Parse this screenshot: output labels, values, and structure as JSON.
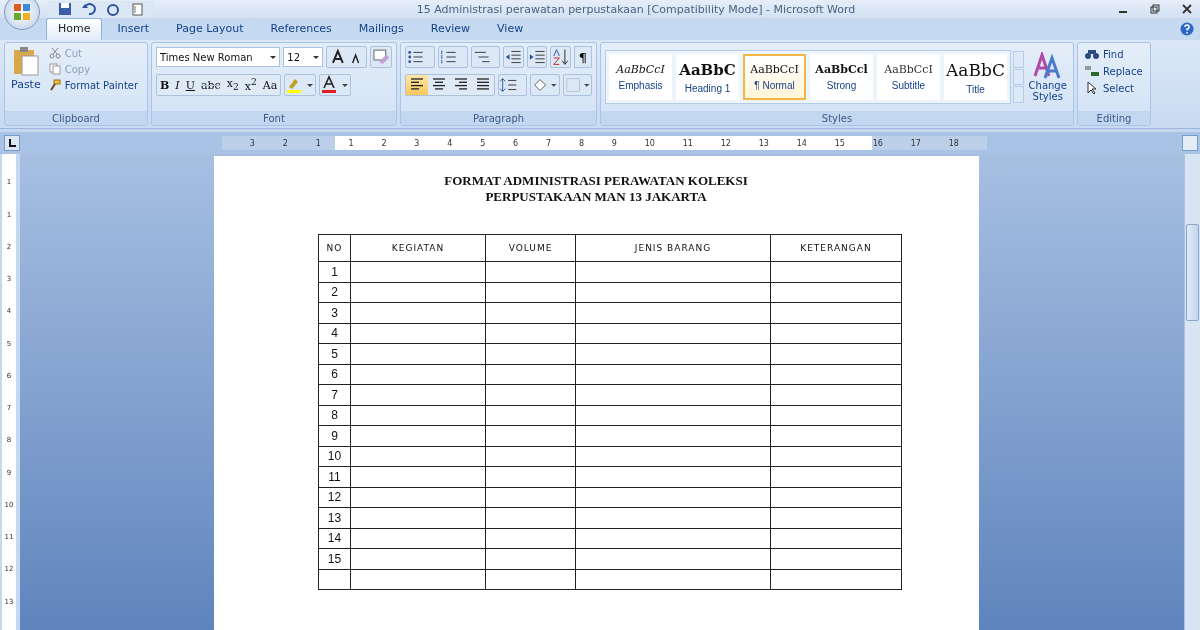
{
  "window": {
    "title": "15 Administrasi perawatan perpustakaan [Compatibility Mode] - Microsoft Word"
  },
  "tabs": [
    {
      "label": "Home",
      "selected": true
    },
    {
      "label": "Insert",
      "selected": false
    },
    {
      "label": "Page Layout",
      "selected": false
    },
    {
      "label": "References",
      "selected": false
    },
    {
      "label": "Mailings",
      "selected": false
    },
    {
      "label": "Review",
      "selected": false
    },
    {
      "label": "View",
      "selected": false
    }
  ],
  "clipboard": {
    "label": "Clipboard",
    "paste": "Paste",
    "items": [
      {
        "label": "Cut",
        "kind": "cut",
        "disabled": true
      },
      {
        "label": "Copy",
        "kind": "copy",
        "disabled": true
      },
      {
        "label": "Format Painter",
        "kind": "painter",
        "disabled": false
      }
    ]
  },
  "font": {
    "label": "Font",
    "font_name": "Times New Roman",
    "font_size": "12",
    "buttons": [
      {
        "text": "B",
        "kind": "bold"
      },
      {
        "text": "I",
        "kind": "italic"
      },
      {
        "text": "U",
        "kind": "underline"
      },
      {
        "text": "abc",
        "kind": "strike"
      },
      {
        "text": "x$_{2}$",
        "kind": "plain"
      },
      {
        "text": "x$^{2}$",
        "kind": "plain"
      },
      {
        "text": "Aa",
        "kind": "plain"
      }
    ]
  },
  "paragraph": {
    "label": "Paragraph",
    "pilcrow": "¶",
    "alignments": [
      {
        "kind": "left",
        "selected": true
      },
      {
        "kind": "center",
        "selected": false
      },
      {
        "kind": "right",
        "selected": false
      },
      {
        "kind": "justify",
        "selected": false
      }
    ]
  },
  "styles": {
    "label": "Styles",
    "items": [
      {
        "preview": "AaBbCcI",
        "name": "Emphasis",
        "kind": "emphasis",
        "selected": false
      },
      {
        "preview": "AaBbC",
        "name": "Heading 1",
        "kind": "heading",
        "selected": false
      },
      {
        "preview": "AaBbCcI",
        "name": "¶ Normal",
        "kind": "normal",
        "selected": true
      },
      {
        "preview": "AaBbCcl",
        "name": "Strong",
        "kind": "strong",
        "selected": false
      },
      {
        "preview": "AaBbCcI",
        "name": "Subtitle",
        "kind": "subtitle",
        "selected": false
      },
      {
        "preview": "AaBbC",
        "name": "Title",
        "kind": "title",
        "selected": false
      }
    ],
    "change_styles": "Change Styles"
  },
  "editing": {
    "label": "Editing",
    "items": [
      {
        "label": "Find",
        "kind": "find"
      },
      {
        "label": "Replace",
        "kind": "replace"
      },
      {
        "label": "Select",
        "kind": "select"
      }
    ]
  },
  "ruler": {
    "labels": [
      "3",
      "2",
      "1",
      "1",
      "2",
      "3",
      "4",
      "5",
      "6",
      "7",
      "8",
      "9",
      "10",
      "11",
      "12",
      "13",
      "14",
      "15",
      "16",
      "17",
      "18"
    ]
  },
  "vertical_ruler": {
    "labels": [
      "1",
      "1",
      "2",
      "3",
      "4",
      "5",
      "6",
      "7",
      "8",
      "9",
      "10",
      "11",
      "12",
      "13"
    ]
  },
  "document": {
    "heading": [
      "FORMAT ADMINISTRASI PERAWATAN KOLEKSI",
      "PERPUSTAKAAN MAN 13 JAKARTA"
    ],
    "table": {
      "columns": [
        "NO",
        "KEGIATAN",
        "VOLUME",
        "JENIS BARANG",
        "KETERANGAN"
      ],
      "rows": [
        {
          "no": "1"
        },
        {
          "no": "2"
        },
        {
          "no": "3"
        },
        {
          "no": "4"
        },
        {
          "no": "5"
        },
        {
          "no": "6"
        },
        {
          "no": "7"
        },
        {
          "no": "8"
        },
        {
          "no": "9"
        },
        {
          "no": "10"
        },
        {
          "no": "11"
        },
        {
          "no": "12"
        },
        {
          "no": "13"
        },
        {
          "no": "14"
        },
        {
          "no": "15"
        },
        {}
      ]
    }
  }
}
